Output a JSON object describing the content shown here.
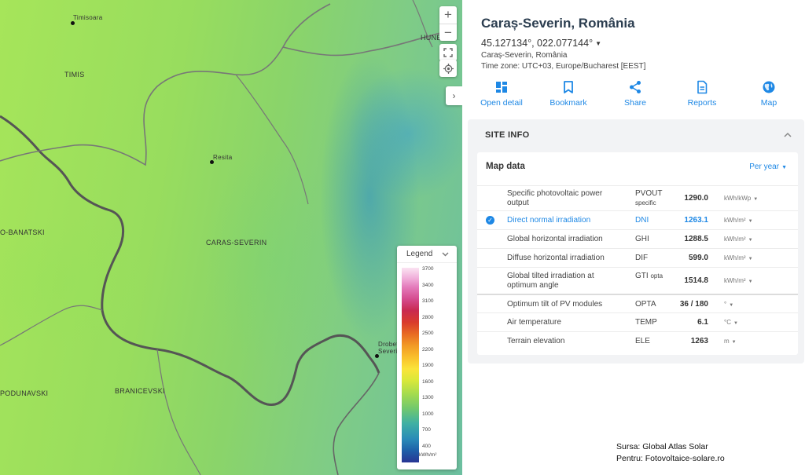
{
  "map": {
    "places": [
      {
        "id": "timisoara",
        "label": "Timisoara"
      },
      {
        "id": "timis",
        "label": "TIMIS"
      },
      {
        "id": "hunedoara",
        "label": "HUNE"
      },
      {
        "id": "resita",
        "label": "Resita"
      },
      {
        "id": "banatski",
        "label": "O-BANATSKI"
      },
      {
        "id": "caras",
        "label": "CARAS-SEVERIN"
      },
      {
        "id": "drobeta",
        "label": "Drobet"
      },
      {
        "id": "drobeta2",
        "label": "Severin"
      },
      {
        "id": "podunavski",
        "label": "PODUNAVSKI"
      },
      {
        "id": "branicevski",
        "label": "BRANICEVSKI"
      }
    ],
    "controls": {
      "zoom_in": "+",
      "zoom_out": "−",
      "expand": "›"
    },
    "legend": {
      "title": "Legend",
      "ticks": [
        "3700",
        "3400",
        "3100",
        "2800",
        "2500",
        "2200",
        "1900",
        "1600",
        "1300",
        "1000",
        "700",
        "400"
      ],
      "unit": "kWh/m²"
    }
  },
  "site": {
    "title": "Caraș-Severin, România",
    "coords": "45.127134°, 022.077144°",
    "region": "Caraș-Severin, România",
    "timezone": "Time zone: UTC+03, Europe/Bucharest [EEST]"
  },
  "actions": [
    {
      "id": "open-detail",
      "label": "Open detail",
      "icon": "grid-icon"
    },
    {
      "id": "bookmark",
      "label": "Bookmark",
      "icon": "bookmark-icon"
    },
    {
      "id": "share",
      "label": "Share",
      "icon": "share-icon"
    },
    {
      "id": "reports",
      "label": "Reports",
      "icon": "document-icon"
    },
    {
      "id": "map",
      "label": "Map",
      "icon": "globe-icon"
    }
  ],
  "site_info": {
    "heading": "SITE INFO",
    "map_data_title": "Map data",
    "period": "Per year",
    "rows": [
      {
        "name": "Specific photovoltaic power output",
        "abbr": "PVOUT",
        "abbr_sub": "specific",
        "value": "1290.0",
        "unit": "kWh/kWp"
      },
      {
        "name": "Direct normal irradiation",
        "abbr": "DNI",
        "abbr_sub": "",
        "value": "1263.1",
        "unit": "kWh/m²"
      },
      {
        "name": "Global horizontal irradiation",
        "abbr": "GHI",
        "abbr_sub": "",
        "value": "1288.5",
        "unit": "kWh/m²"
      },
      {
        "name": "Diffuse horizontal irradiation",
        "abbr": "DIF",
        "abbr_sub": "",
        "value": "599.0",
        "unit": "kWh/m²"
      },
      {
        "name": "Global tilted irradiation at optimum angle",
        "abbr": "GTI",
        "abbr_sub": "opta",
        "value": "1514.8",
        "unit": "kWh/m²"
      },
      {
        "name": "Optimum tilt of PV modules",
        "abbr": "OPTA",
        "abbr_sub": "",
        "value": "36 /  180",
        "unit": "°"
      },
      {
        "name": "Air temperature",
        "abbr": "TEMP",
        "abbr_sub": "",
        "value": "6.1",
        "unit": "°C"
      },
      {
        "name": "Terrain elevation",
        "abbr": "ELE",
        "abbr_sub": "",
        "value": "1263",
        "unit": "m"
      }
    ]
  },
  "credit": {
    "line1": "Sursa: Global Atlas Solar",
    "line2": "Pentru: Fotovoltaice-solare.ro"
  },
  "colors": {
    "accent": "#1e88e5",
    "title": "#2c3e50"
  }
}
